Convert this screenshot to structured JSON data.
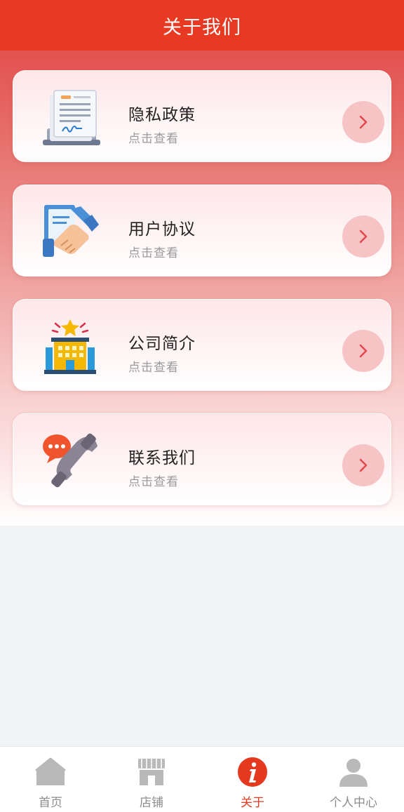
{
  "header": {
    "title": "关于我们"
  },
  "cards": [
    {
      "title": "隐私政策",
      "subtitle": "点击查看",
      "icon": "document-signature-icon"
    },
    {
      "title": "用户协议",
      "subtitle": "点击查看",
      "icon": "handshake-agreement-icon"
    },
    {
      "title": "公司简介",
      "subtitle": "点击查看",
      "icon": "company-building-icon"
    },
    {
      "title": "联系我们",
      "subtitle": "点击查看",
      "icon": "phone-chat-icon"
    }
  ],
  "tabs": [
    {
      "label": "首页",
      "icon": "home-icon",
      "active": false
    },
    {
      "label": "店铺",
      "icon": "store-icon",
      "active": false
    },
    {
      "label": "关于",
      "icon": "info-icon",
      "active": true
    },
    {
      "label": "个人中心",
      "icon": "user-icon",
      "active": false
    }
  ],
  "colors": {
    "header": "#e83a22",
    "active_tab": "#e03a22",
    "arrow_button": "#f7c4c6",
    "arrow": "#e04a4e"
  }
}
